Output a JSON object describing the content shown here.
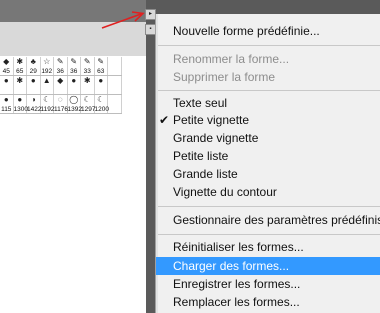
{
  "menu": {
    "items": [
      {
        "label": "Nouvelle forme prédéfinie...",
        "disabled": false
      },
      {
        "label": "Renommer la forme...",
        "disabled": true
      },
      {
        "label": "Supprimer la forme",
        "disabled": true
      },
      {
        "label": "Texte seul",
        "disabled": false
      },
      {
        "label": "Petite vignette",
        "disabled": false,
        "checked": true
      },
      {
        "label": "Grande vignette",
        "disabled": false
      },
      {
        "label": "Petite liste",
        "disabled": false
      },
      {
        "label": "Grande liste",
        "disabled": false
      },
      {
        "label": "Vignette du contour",
        "disabled": false
      },
      {
        "label": "Gestionnaire des paramètres prédéfinis",
        "disabled": false
      },
      {
        "label": "Réinitialiser les formes...",
        "disabled": false
      },
      {
        "label": "Charger des formes...",
        "disabled": false,
        "highlighted": true
      },
      {
        "label": "Enregistrer les formes...",
        "disabled": false
      },
      {
        "label": "Remplacer les formes...",
        "disabled": false
      }
    ]
  },
  "brush_grid": {
    "rows": [
      [
        "45",
        "65",
        "29",
        "192",
        "36",
        "36",
        "33",
        "63",
        ""
      ],
      [
        "",
        "",
        "",
        "",
        "",
        "",
        "",
        "",
        ""
      ],
      [
        "115",
        "1300",
        "1422",
        "1192",
        "1176",
        "1392",
        "1297",
        "1200",
        ""
      ]
    ]
  },
  "colors": {
    "highlight": "#3399ff",
    "annotation_arrow": "#e02020"
  },
  "icons": {
    "panel_menu": "triangle-right-icon",
    "panel_button": "panel-options-icon"
  }
}
